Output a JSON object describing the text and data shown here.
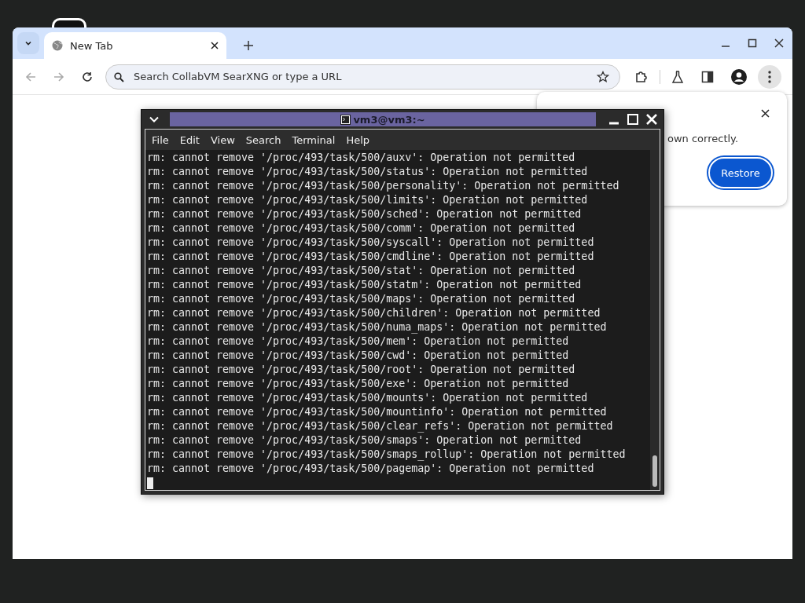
{
  "browser": {
    "tab": {
      "title": "New Tab",
      "selected": true
    },
    "address_bar": {
      "placeholder": "Search CollabVM SearXNG or type a URL"
    }
  },
  "restore_popup": {
    "message": "own correctly.",
    "button": "Restore"
  },
  "terminal": {
    "title": "vm3@vm3:~",
    "menu": [
      "File",
      "Edit",
      "View",
      "Search",
      "Terminal",
      "Help"
    ],
    "lines": [
      "rm: cannot remove '/proc/493/task/500/auxv': Operation not permitted",
      "rm: cannot remove '/proc/493/task/500/status': Operation not permitted",
      "rm: cannot remove '/proc/493/task/500/personality': Operation not permitted",
      "rm: cannot remove '/proc/493/task/500/limits': Operation not permitted",
      "rm: cannot remove '/proc/493/task/500/sched': Operation not permitted",
      "rm: cannot remove '/proc/493/task/500/comm': Operation not permitted",
      "rm: cannot remove '/proc/493/task/500/syscall': Operation not permitted",
      "rm: cannot remove '/proc/493/task/500/cmdline': Operation not permitted",
      "rm: cannot remove '/proc/493/task/500/stat': Operation not permitted",
      "rm: cannot remove '/proc/493/task/500/statm': Operation not permitted",
      "rm: cannot remove '/proc/493/task/500/maps': Operation not permitted",
      "rm: cannot remove '/proc/493/task/500/children': Operation not permitted",
      "rm: cannot remove '/proc/493/task/500/numa_maps': Operation not permitted",
      "rm: cannot remove '/proc/493/task/500/mem': Operation not permitted",
      "rm: cannot remove '/proc/493/task/500/cwd': Operation not permitted",
      "rm: cannot remove '/proc/493/task/500/root': Operation not permitted",
      "rm: cannot remove '/proc/493/task/500/exe': Operation not permitted",
      "rm: cannot remove '/proc/493/task/500/mounts': Operation not permitted",
      "rm: cannot remove '/proc/493/task/500/mountinfo': Operation not permitted",
      "rm: cannot remove '/proc/493/task/500/clear_refs': Operation not permitted",
      "rm: cannot remove '/proc/493/task/500/smaps': Operation not permitted",
      "rm: cannot remove '/proc/493/task/500/smaps_rollup': Operation not permitted",
      "rm: cannot remove '/proc/493/task/500/pagemap': Operation not permitted"
    ]
  }
}
